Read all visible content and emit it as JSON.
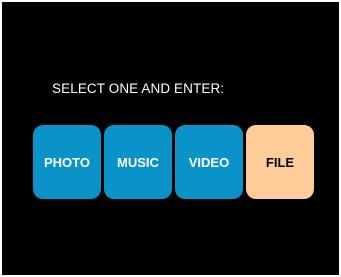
{
  "prompt": "SELECT ONE AND ENTER:",
  "options": [
    {
      "label": "PHOTO",
      "selected": false
    },
    {
      "label": "MUSIC",
      "selected": false
    },
    {
      "label": "VIDEO",
      "selected": false
    },
    {
      "label": "FILE",
      "selected": true
    }
  ],
  "colors": {
    "background": "#000000",
    "option": "#0a93c9",
    "selected": "#ffcc99",
    "text": "#ffffff",
    "selected_text": "#000000"
  }
}
